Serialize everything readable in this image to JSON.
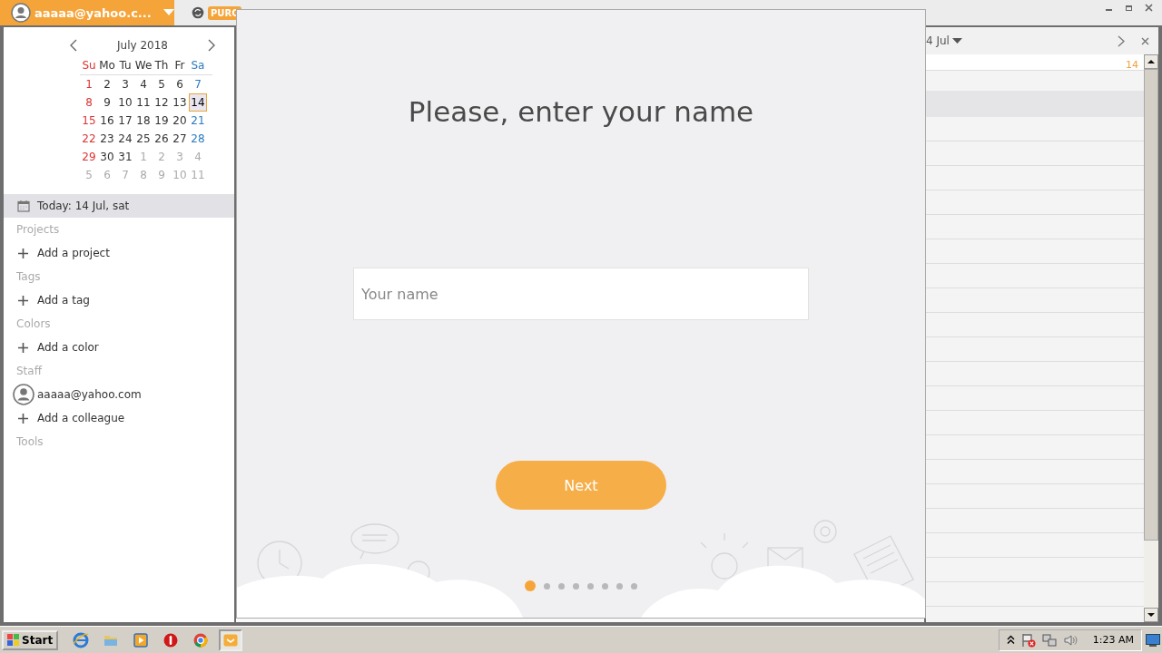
{
  "account": {
    "email": "aaaaa@yahoo.c..."
  },
  "top_tab": {
    "badge": "PURC"
  },
  "calendar": {
    "month": "July 2018",
    "weekdays": [
      "Su",
      "Mo",
      "Tu",
      "We",
      "Th",
      "Fr",
      "Sa"
    ],
    "weeks": [
      [
        {
          "day": "1",
          "kind": "current",
          "selected": false
        },
        {
          "day": "2",
          "kind": "current",
          "selected": false
        },
        {
          "day": "3",
          "kind": "current",
          "selected": false
        },
        {
          "day": "4",
          "kind": "current",
          "selected": false
        },
        {
          "day": "5",
          "kind": "current",
          "selected": false
        },
        {
          "day": "6",
          "kind": "current",
          "selected": false
        },
        {
          "day": "7",
          "kind": "current",
          "selected": false
        }
      ],
      [
        {
          "day": "8",
          "kind": "current",
          "selected": false
        },
        {
          "day": "9",
          "kind": "current",
          "selected": false
        },
        {
          "day": "10",
          "kind": "current",
          "selected": false
        },
        {
          "day": "11",
          "kind": "current",
          "selected": false
        },
        {
          "day": "12",
          "kind": "current",
          "selected": false
        },
        {
          "day": "13",
          "kind": "current",
          "selected": false
        },
        {
          "day": "14",
          "kind": "current",
          "selected": true
        }
      ],
      [
        {
          "day": "15",
          "kind": "current",
          "selected": false
        },
        {
          "day": "16",
          "kind": "current",
          "selected": false
        },
        {
          "day": "17",
          "kind": "current",
          "selected": false
        },
        {
          "day": "18",
          "kind": "current",
          "selected": false
        },
        {
          "day": "19",
          "kind": "current",
          "selected": false
        },
        {
          "day": "20",
          "kind": "current",
          "selected": false
        },
        {
          "day": "21",
          "kind": "current",
          "selected": false
        }
      ],
      [
        {
          "day": "22",
          "kind": "current",
          "selected": false
        },
        {
          "day": "23",
          "kind": "current",
          "selected": false
        },
        {
          "day": "24",
          "kind": "current",
          "selected": false
        },
        {
          "day": "25",
          "kind": "current",
          "selected": false
        },
        {
          "day": "26",
          "kind": "current",
          "selected": false
        },
        {
          "day": "27",
          "kind": "current",
          "selected": false
        },
        {
          "day": "28",
          "kind": "current",
          "selected": false
        }
      ],
      [
        {
          "day": "29",
          "kind": "current",
          "selected": false
        },
        {
          "day": "30",
          "kind": "current",
          "selected": false
        },
        {
          "day": "31",
          "kind": "current",
          "selected": false
        },
        {
          "day": "1",
          "kind": "other",
          "selected": false
        },
        {
          "day": "2",
          "kind": "other",
          "selected": false
        },
        {
          "day": "3",
          "kind": "other",
          "selected": false
        },
        {
          "day": "4",
          "kind": "other",
          "selected": false
        }
      ],
      [
        {
          "day": "5",
          "kind": "other",
          "selected": false
        },
        {
          "day": "6",
          "kind": "other",
          "selected": false
        },
        {
          "day": "7",
          "kind": "other",
          "selected": false
        },
        {
          "day": "8",
          "kind": "other",
          "selected": false
        },
        {
          "day": "9",
          "kind": "other",
          "selected": false
        },
        {
          "day": "10",
          "kind": "other",
          "selected": false
        },
        {
          "day": "11",
          "kind": "other",
          "selected": false
        }
      ]
    ]
  },
  "today": "Today: 14 Jul, sat",
  "sidebar_sections": [
    {
      "title": "Projects",
      "items": [
        {
          "kind": "add",
          "label": "Add a project"
        }
      ]
    },
    {
      "title": "Tags",
      "items": [
        {
          "kind": "add",
          "label": "Add a tag"
        }
      ]
    },
    {
      "title": "Colors",
      "items": [
        {
          "kind": "add",
          "label": "Add a color"
        }
      ]
    },
    {
      "title": "Staff",
      "items": [
        {
          "kind": "user",
          "label": "aaaaa@yahoo.com"
        },
        {
          "kind": "add",
          "label": "Add a colleague"
        }
      ]
    },
    {
      "title": "Tools"
    }
  ],
  "right_panel": {
    "date": "4 Jul",
    "day_number": "14"
  },
  "dialog": {
    "title": "Please, enter your name",
    "name_field": {
      "placeholder": "Your name"
    },
    "next_button": "Next",
    "pages": [
      {
        "selected": true
      },
      {
        "selected": false
      },
      {
        "selected": false
      },
      {
        "selected": false
      },
      {
        "selected": false
      },
      {
        "selected": false
      },
      {
        "selected": false
      },
      {
        "selected": false
      }
    ]
  },
  "taskbar": {
    "start": "Start",
    "apps": [
      {
        "kind": "browser",
        "selected": false
      },
      {
        "kind": "folder",
        "selected": false
      },
      {
        "kind": "media",
        "selected": false
      },
      {
        "kind": "stop",
        "selected": false
      },
      {
        "kind": "chrome",
        "selected": false
      },
      {
        "kind": "mail",
        "selected": true
      }
    ],
    "clock": "1:23 AM"
  }
}
